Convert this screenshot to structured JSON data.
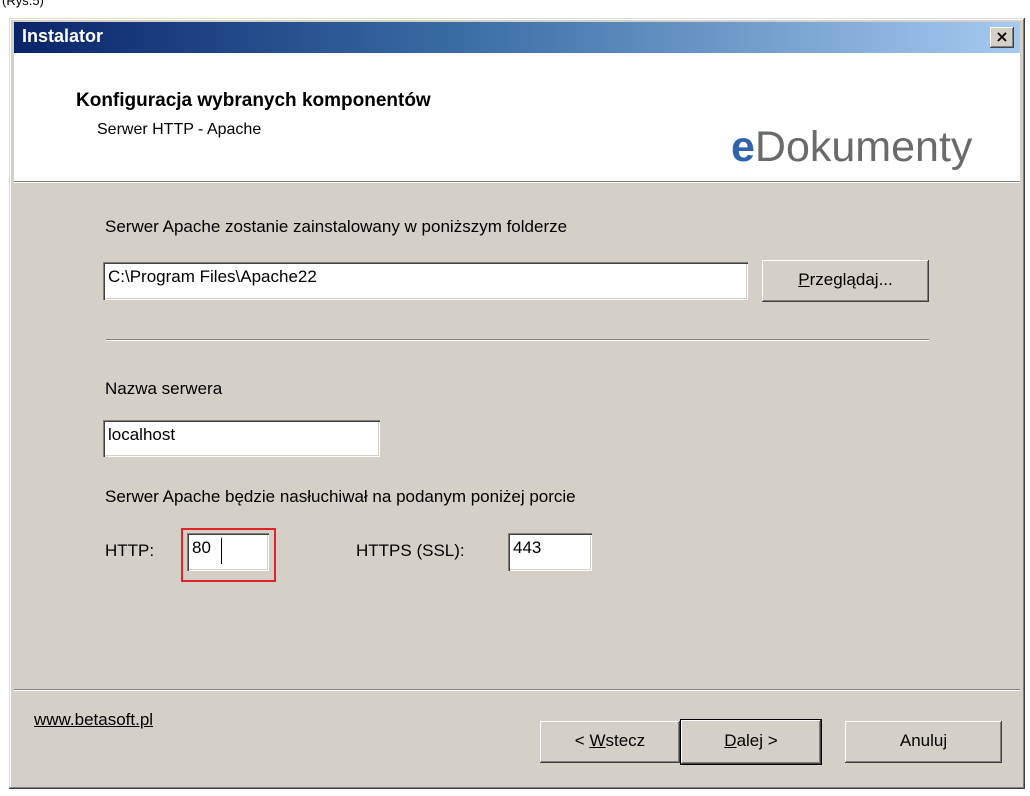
{
  "caption": "(Rys.5)",
  "window": {
    "title": "Instalator",
    "close_label": "×"
  },
  "header": {
    "title": "Konfiguracja wybranych komponentów",
    "subtitle": "Serwer HTTP - Apache",
    "logo_e": "e",
    "logo_rest": "Dokumenty",
    "logo_color": "#2f63ad"
  },
  "install": {
    "label": "Serwer Apache zostanie zainstalowany w poniższym folderze",
    "path_value": "C:\\Program Files\\Apache22",
    "browse_accel": "P",
    "browse_rest": "rzeglądaj..."
  },
  "server": {
    "name_label": "Nazwa serwera",
    "name_value": "localhost",
    "port_label": "Serwer Apache będzie nasłuchiwał na podanym poniżej porcie",
    "http_label": "HTTP:",
    "http_value": "80",
    "https_label": "HTTPS (SSL):",
    "https_value": "443",
    "highlight_color": "#e2232a"
  },
  "footer": {
    "link": "www.betasoft.pl",
    "back_prefix": "< ",
    "back_accel": "W",
    "back_rest": "stecz",
    "next_accel": "D",
    "next_rest": "alej >",
    "cancel_label": "Anuluj"
  }
}
